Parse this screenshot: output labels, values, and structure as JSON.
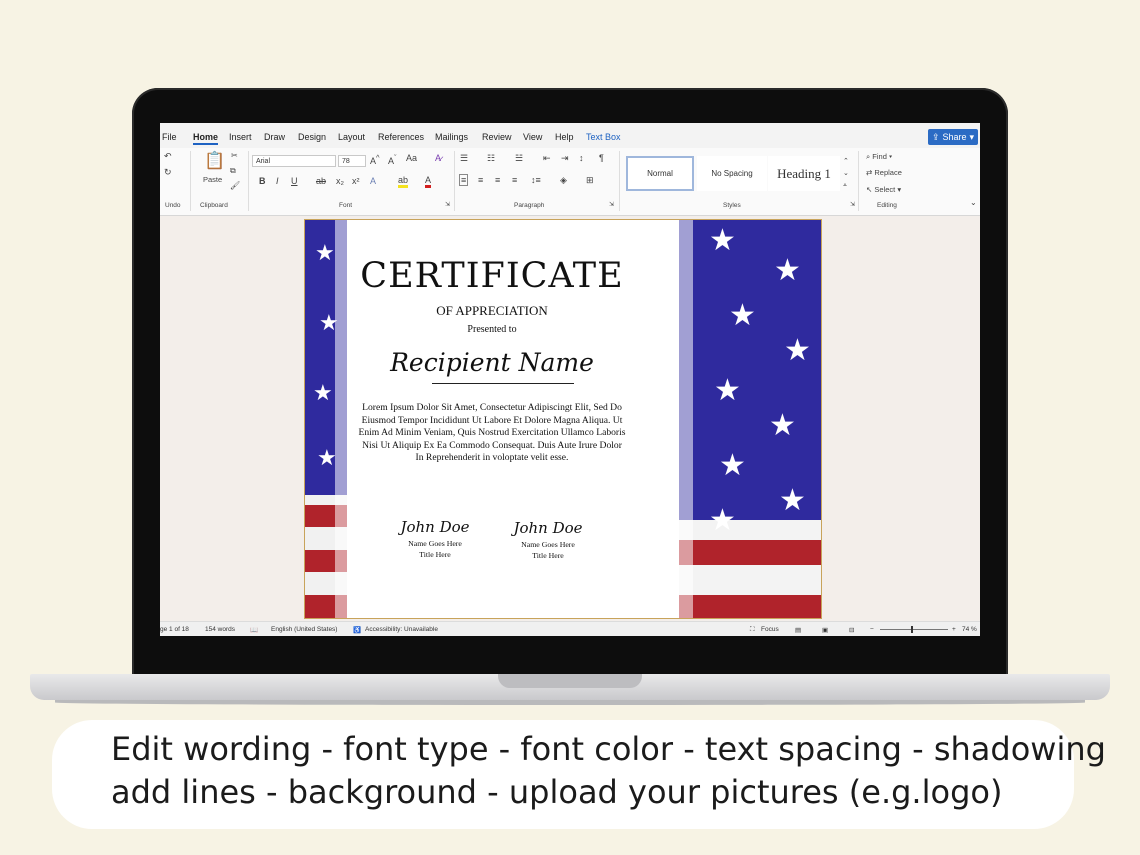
{
  "menu": {
    "items": [
      "File",
      "Home",
      "Insert",
      "Draw",
      "Design",
      "Layout",
      "References",
      "Mailings",
      "Review",
      "View",
      "Help",
      "Text Box"
    ],
    "share": "Share"
  },
  "ribbon": {
    "groups": {
      "undo": "Undo",
      "clipboard": "Clipboard",
      "font": "Font",
      "paragraph": "Paragraph",
      "styles": "Styles",
      "editing": "Editing"
    },
    "paste": "Paste",
    "font_name": "Arial",
    "font_size": "78",
    "styles": [
      "Normal",
      "No Spacing",
      "Heading 1"
    ],
    "find": "Find",
    "replace": "Replace",
    "select": "Select"
  },
  "certificate": {
    "title": "CERTIFICATE",
    "subtitle": "OF APPRECIATION",
    "presented": "Presented to",
    "recipient": "Recipient Name",
    "body": "Lorem Ipsum Dolor Sit Amet, Consectetur Adipiscingt Elit, Sed Do Eiusmod Tempor Incididunt Ut Labore Et Dolore Magna Aliqua. Ut Enim Ad Minim Veniam, Quis Nostrud Exercitation Ullamco Laboris Nisi Ut Aliquip Ex Ea Commodo Consequat. Duis Aute Irure Dolor In Reprehenderit in voloptate velit esse.",
    "signatures": [
      {
        "script": "John Doe",
        "name": "Name Goes Here",
        "title": "Title Here"
      },
      {
        "script": "John Doe",
        "name": "Name Goes Here",
        "title": "Title Here"
      }
    ]
  },
  "status": {
    "page": "ge 1 of 18",
    "words": "154 words",
    "language": "English (United States)",
    "accessibility": "Accessibility: Unavailable",
    "focus": "Focus",
    "zoom": "74 %",
    "zoom_level": 0.47
  },
  "caption": {
    "line1": "Edit wording - font type - font color - text spacing - shadowing",
    "line2": "add lines - background -  upload your pictures (e.g.logo)"
  },
  "colors": {
    "flag_blue": "#2f2a9e",
    "flag_red": "#b0232b",
    "share": "#2b6bc4",
    "accent": "#1e62c2"
  }
}
